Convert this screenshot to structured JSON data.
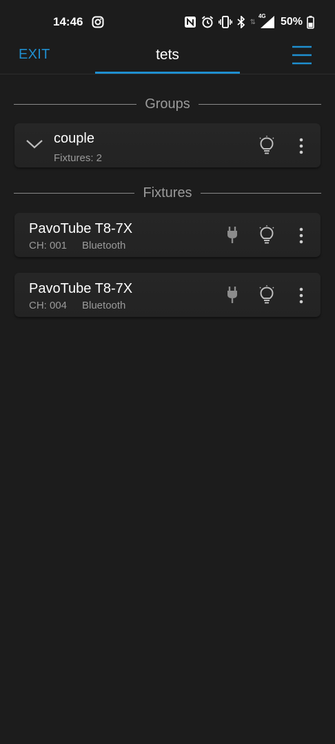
{
  "status_bar": {
    "time": "14:46",
    "network": "4G",
    "battery": "50%",
    "icons": [
      "instagram-icon",
      "nfc-icon",
      "alarm-icon",
      "vibrate-icon",
      "bluetooth-icon",
      "signal-icon",
      "battery-icon"
    ]
  },
  "app_bar": {
    "exit_label": "EXIT",
    "title": "tets",
    "menu_icon": "hamburger-menu-icon",
    "accent_color": "#1f8fd0"
  },
  "groups": {
    "header": "Groups",
    "items": [
      {
        "name": "couple",
        "subtitle": "Fixtures: 2"
      }
    ]
  },
  "fixtures": {
    "header": "Fixtures",
    "items": [
      {
        "name": "PavoTube T8-7X",
        "channel": "CH: 001",
        "connection": "Bluetooth"
      },
      {
        "name": "PavoTube T8-7X",
        "channel": "CH: 004",
        "connection": "Bluetooth"
      }
    ]
  },
  "colors": {
    "background": "#1c1c1c",
    "card": "#252525",
    "muted_text": "#9a9a9a"
  }
}
